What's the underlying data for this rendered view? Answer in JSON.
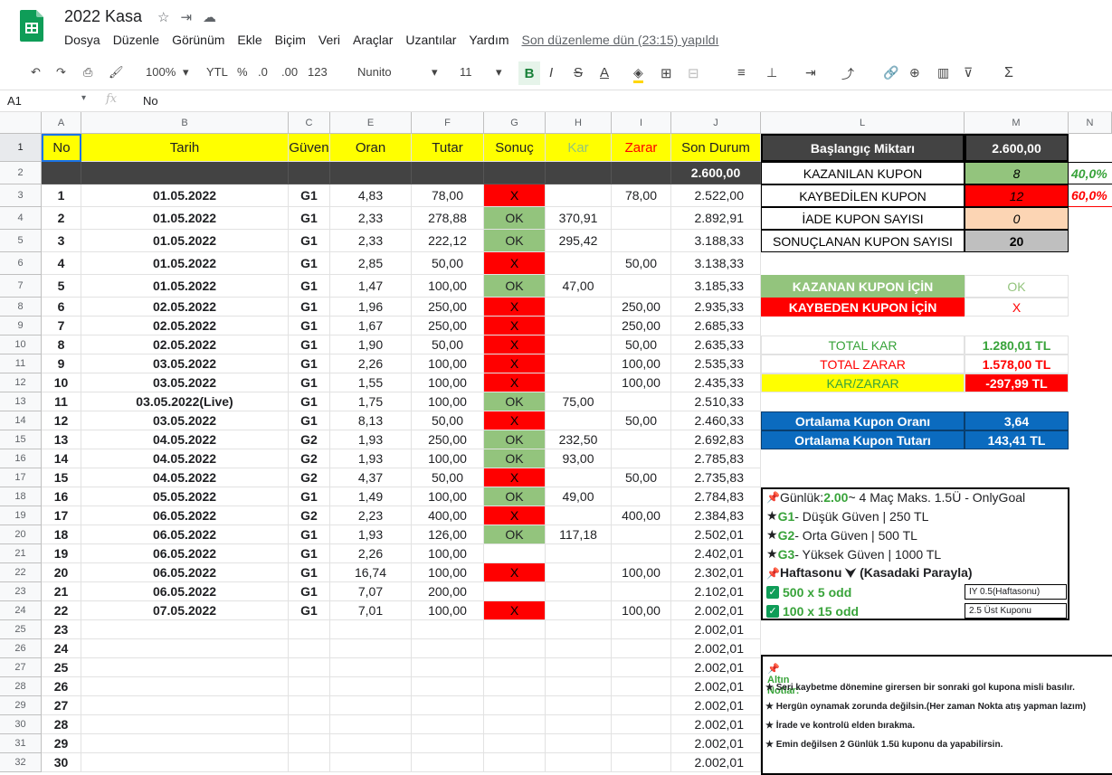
{
  "app": {
    "title": "2022 Kasa",
    "last_edit": "Son düzenleme dün (23:15) yapıldı"
  },
  "menus": [
    "Dosya",
    "Düzenle",
    "Görünüm",
    "Ekle",
    "Biçim",
    "Veri",
    "Araçlar",
    "Uzantılar",
    "Yardım"
  ],
  "toolbar": {
    "zoom": "100%",
    "currency": "YTL",
    "percent": "%",
    "dec_less": ".0",
    "dec_more": ".00",
    "format": "123",
    "font": "Nunito",
    "size": "11"
  },
  "formula": {
    "ref": "A1",
    "fx": "fx",
    "value": "No"
  },
  "columns": [
    "A",
    "B",
    "C",
    "E",
    "F",
    "G",
    "H",
    "I",
    "J",
    "L",
    "M",
    "N"
  ],
  "headers": [
    "No",
    "Tarih",
    "Güven",
    "Oran",
    "Tutar",
    "Sonuç",
    "Kar",
    "Zarar",
    "Son Durum"
  ],
  "start_balance": "2.600,00",
  "rows": [
    [
      "1",
      "01.05.2022",
      "G1",
      "4,83",
      "78,00",
      "X",
      "",
      "78,00",
      "2.522,00"
    ],
    [
      "2",
      "01.05.2022",
      "G1",
      "2,33",
      "278,88",
      "OK",
      "370,91",
      "",
      "2.892,91"
    ],
    [
      "3",
      "01.05.2022",
      "G1",
      "2,33",
      "222,12",
      "OK",
      "295,42",
      "",
      "3.188,33"
    ],
    [
      "4",
      "01.05.2022",
      "G1",
      "2,85",
      "50,00",
      "X",
      "",
      "50,00",
      "3.138,33"
    ],
    [
      "5",
      "01.05.2022",
      "G1",
      "1,47",
      "100,00",
      "OK",
      "47,00",
      "",
      "3.185,33"
    ],
    [
      "6",
      "02.05.2022",
      "G1",
      "1,96",
      "250,00",
      "X",
      "",
      "250,00",
      "2.935,33"
    ],
    [
      "7",
      "02.05.2022",
      "G1",
      "1,67",
      "250,00",
      "X",
      "",
      "250,00",
      "2.685,33"
    ],
    [
      "8",
      "02.05.2022",
      "G1",
      "1,90",
      "50,00",
      "X",
      "",
      "50,00",
      "2.635,33"
    ],
    [
      "9",
      "03.05.2022",
      "G1",
      "2,26",
      "100,00",
      "X",
      "",
      "100,00",
      "2.535,33"
    ],
    [
      "10",
      "03.05.2022",
      "G1",
      "1,55",
      "100,00",
      "X",
      "",
      "100,00",
      "2.435,33"
    ],
    [
      "11",
      "03.05.2022(Live)",
      "G1",
      "1,75",
      "100,00",
      "OK",
      "75,00",
      "",
      "2.510,33"
    ],
    [
      "12",
      "03.05.2022",
      "G1",
      "8,13",
      "50,00",
      "X",
      "",
      "50,00",
      "2.460,33"
    ],
    [
      "13",
      "04.05.2022",
      "G2",
      "1,93",
      "250,00",
      "OK",
      "232,50",
      "",
      "2.692,83"
    ],
    [
      "14",
      "04.05.2022",
      "G2",
      "1,93",
      "100,00",
      "OK",
      "93,00",
      "",
      "2.785,83"
    ],
    [
      "15",
      "04.05.2022",
      "G2",
      "4,37",
      "50,00",
      "X",
      "",
      "50,00",
      "2.735,83"
    ],
    [
      "16",
      "05.05.2022",
      "G1",
      "1,49",
      "100,00",
      "OK",
      "49,00",
      "",
      "2.784,83"
    ],
    [
      "17",
      "06.05.2022",
      "G2",
      "2,23",
      "400,00",
      "X",
      "",
      "400,00",
      "2.384,83"
    ],
    [
      "18",
      "06.05.2022",
      "G1",
      "1,93",
      "126,00",
      "OK",
      "117,18",
      "",
      "2.502,01"
    ],
    [
      "19",
      "06.05.2022",
      "G1",
      "2,26",
      "100,00",
      "",
      "",
      "",
      "2.402,01"
    ],
    [
      "20",
      "06.05.2022",
      "G1",
      "16,74",
      "100,00",
      "X",
      "",
      "100,00",
      "2.302,01"
    ],
    [
      "21",
      "06.05.2022",
      "G1",
      "7,07",
      "200,00",
      "",
      "",
      "",
      "2.102,01"
    ],
    [
      "22",
      "07.05.2022",
      "G1",
      "7,01",
      "100,00",
      "X",
      "",
      "100,00",
      "2.002,01"
    ],
    [
      "23",
      "",
      "",
      "",
      "",
      "",
      "",
      "",
      "2.002,01"
    ],
    [
      "24",
      "",
      "",
      "",
      "",
      "",
      "",
      "",
      "2.002,01"
    ],
    [
      "25",
      "",
      "",
      "",
      "",
      "",
      "",
      "",
      "2.002,01"
    ],
    [
      "26",
      "",
      "",
      "",
      "",
      "",
      "",
      "",
      "2.002,01"
    ],
    [
      "27",
      "",
      "",
      "",
      "",
      "",
      "",
      "",
      "2.002,01"
    ],
    [
      "28",
      "",
      "",
      "",
      "",
      "",
      "",
      "",
      "2.002,01"
    ],
    [
      "29",
      "",
      "",
      "",
      "",
      "",
      "",
      "",
      "2.002,01"
    ],
    [
      "30",
      "",
      "",
      "",
      "",
      "",
      "",
      "",
      "2.002,01"
    ]
  ],
  "summary": {
    "start_label": "Başlangıç Miktarı",
    "start_value": "2.600,00",
    "won_label": "KAZANILAN KUPON",
    "won_value": "8",
    "won_pct": "40,0%",
    "lost_label": "KAYBEDİLEN KUPON",
    "lost_value": "12",
    "lost_pct": "60,0%",
    "refund_label": "İADE KUPON SAYISI",
    "refund_value": "0",
    "settled_label": "SONUÇLANAN KUPON SAYISI",
    "settled_value": "20",
    "win_key_label": "KAZANAN KUPON İÇİN",
    "win_key_value": "OK",
    "lose_key_label": "KAYBEDEN KUPON İÇİN",
    "lose_key_value": "X",
    "total_kar_label": "TOTAL KAR",
    "total_kar_value": "1.280,01 TL",
    "total_zarar_label": "TOTAL ZARAR",
    "total_zarar_value": "1.578,00 TL",
    "karzarar_label": "KAR/ZARAR",
    "karzarar_value": "-297,99 TL",
    "avg_odds_label": "Ortalama Kupon Oranı",
    "avg_odds_value": "3,64",
    "avg_stake_label": "Ortalama Kupon Tutarı",
    "avg_stake_value": "143,41 TL"
  },
  "plan": {
    "daily_prefix": "Günlük: ",
    "daily_green": "2.00",
    "daily_rest": " ~ 4 Maç Maks. 1.5Ü - OnlyGoal",
    "g1_code": "G1",
    "g1_rest": " - Düşük Güven | 250 TL",
    "g2_code": "G2",
    "g2_rest": " - Orta Güven | 500 TL",
    "g3_code": "G3",
    "g3_rest": " - Yüksek Güven | 1000 TL",
    "weekend": "Haftasonu ⮟ (Kasadaki Parayla)",
    "odd1": "500 x 5 odd",
    "odd1_note": "IY 0.5(Haftasonu)",
    "odd2": "100 x 15 odd",
    "odd2_note": "2.5 Üst Kuponu"
  },
  "notes": {
    "title": "Altın Notlar:",
    "items": [
      "★ Seri kaybetme dönemine girersen bir sonraki gol kupona misli basılır.",
      "★ Hergün oynamak zorunda değilsin.(Her zaman Nokta atış yapman lazım)",
      "★ İrade ve kontrolü elden bırakma.",
      "★ Emin değilsen 2 Günlük 1.5ü kuponu da yapabilirsin."
    ]
  },
  "colors": {
    "yellow": "#ffff00",
    "red": "#ff0000",
    "green": "#93c47d",
    "dark": "#434343",
    "blue": "#0b6bbf",
    "peach": "#fcd5b4",
    "grey": "#bfbfbf"
  }
}
